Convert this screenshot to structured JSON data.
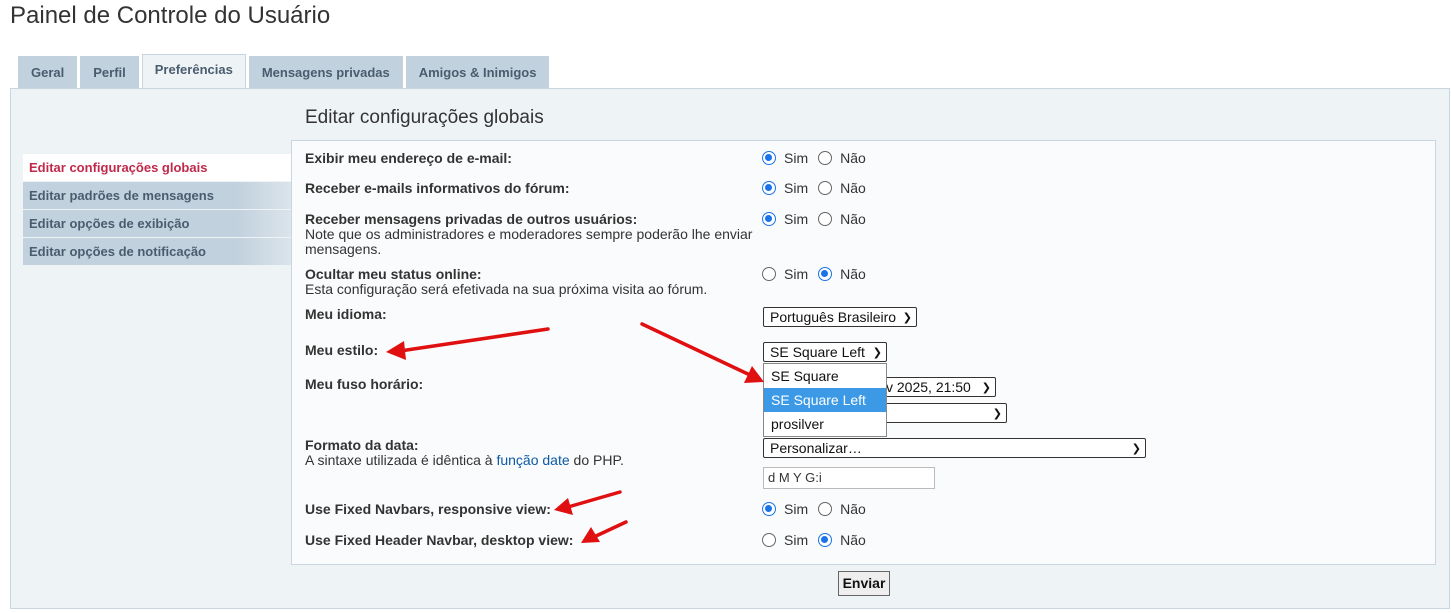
{
  "page_title": "Painel de Controle do Usuário",
  "tabs": [
    {
      "label": "Geral"
    },
    {
      "label": "Perfil"
    },
    {
      "label": "Preferências"
    },
    {
      "label": "Mensagens privadas"
    },
    {
      "label": "Amigos & Inimigos"
    }
  ],
  "section_title": "Editar configurações globais",
  "sidebar": {
    "items": [
      {
        "label": "Editar configurações globais"
      },
      {
        "label": "Editar padrões de mensagens"
      },
      {
        "label": "Editar opções de exibição"
      },
      {
        "label": "Editar opções de notificação"
      }
    ]
  },
  "radio_labels": {
    "yes": "Sim",
    "no": "Não"
  },
  "settings": {
    "show_email": {
      "label": "Exibir meu endereço de e-mail:",
      "value": "Sim"
    },
    "receive_emails": {
      "label": "Receber e-mails informativos do fórum:",
      "value": "Sim"
    },
    "receive_pm": {
      "label": "Receber mensagens privadas de outros usuários:",
      "note": "Note que os administradores e moderadores sempre poderão lhe enviar mensagens.",
      "value": "Sim"
    },
    "hide_online": {
      "label": "Ocultar meu status online:",
      "note": "Esta configuração será efetivada na sua próxima visita ao fórum.",
      "value": "Não"
    },
    "language": {
      "label": "Meu idioma:",
      "value": "Português Brasileiro"
    },
    "style": {
      "label": "Meu estilo:",
      "value": "SE Square Left",
      "options": [
        "SE Square",
        "SE Square Left",
        "prosilver"
      ]
    },
    "timezone": {
      "label": "Meu fuso horário:",
      "date_value": "v 2025, 21:50",
      "zone_value": ""
    },
    "date_format": {
      "label": "Formato da data:",
      "note_prefix": "A sintaxe utilizada é idêntica à ",
      "note_link": "função date",
      "note_suffix": " do PHP.",
      "value": "Personalizar…",
      "custom_value": "d M Y G:i"
    },
    "fixed_navbars": {
      "label": "Use Fixed Navbars, responsive view:",
      "value": "Sim"
    },
    "fixed_header": {
      "label": "Use Fixed Header Navbar, desktop view:",
      "value": "Não"
    }
  },
  "submit_label": "Enviar",
  "annotation_color": "#e01010"
}
